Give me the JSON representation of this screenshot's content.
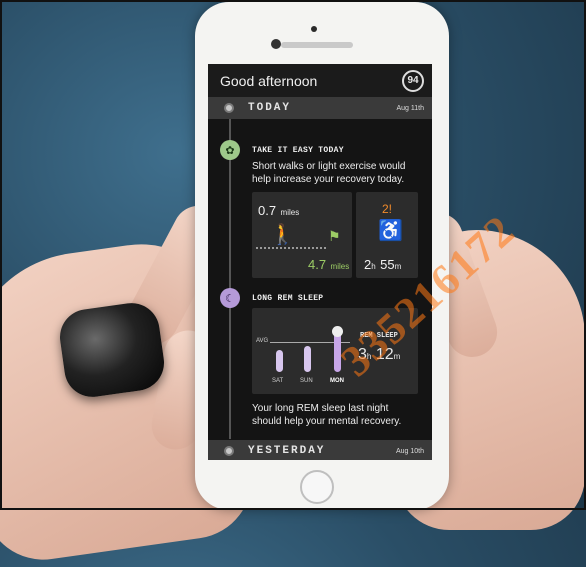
{
  "header": {
    "greeting": "Good afternoon",
    "score": "94"
  },
  "today": {
    "label": "TODAY",
    "date": "Aug 11th"
  },
  "recovery": {
    "title": "TAKE IT EASY TODAY",
    "text_line1": "Short walks or light exercise would",
    "text_line2": "help increase your recovery today.",
    "walk_done_value": "0.7",
    "walk_done_unit": "miles",
    "walk_goal_value": "4.7",
    "walk_goal_unit": "miles",
    "sit_alert": "2!",
    "sit_hours": "2",
    "sit_hours_unit": "h",
    "sit_minutes": "55",
    "sit_minutes_unit": "m"
  },
  "sleep": {
    "title": "LONG REM SLEEP",
    "avg_label": "AVG",
    "days": [
      "SAT",
      "SUN",
      "MON"
    ],
    "rem_label": "REM SLEEP",
    "rem_hours": "3",
    "rem_hours_unit": "h",
    "rem_minutes": "12",
    "rem_minutes_unit": "m",
    "text_line1": "Your long REM sleep last night",
    "text_line2": "should help your mental recovery."
  },
  "yesterday": {
    "label": "YESTERDAY",
    "date": "Aug 10th"
  },
  "watermark": "335216172",
  "colors": {
    "recovery_icon": "#9ec98a",
    "sleep_icon": "#b59ad8",
    "walk_green": "#9ccc65",
    "alert_orange": "#f08a2b"
  }
}
